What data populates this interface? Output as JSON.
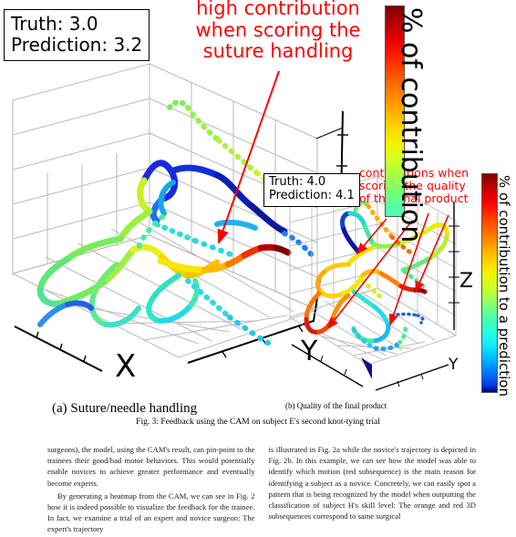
{
  "figure": {
    "subplot_a": {
      "prediction_box": {
        "truth_label": "Truth: 3.0",
        "prediction_label": "Prediction: 3.2"
      },
      "red_annotation": {
        "line1": "high contribution",
        "line2": "when scoring the",
        "line3": "suture handling"
      },
      "axis_x_label": "X",
      "axis_y_label": "Y",
      "caption": "(a) Suture/needle handling"
    },
    "subplot_b": {
      "prediction_box": {
        "truth_label": "Truth: 4.0",
        "prediction_label": "Prediction: 4.1"
      },
      "red_annotation": {
        "line1": "contributions when",
        "line2": "scoring the quality",
        "line3": "of the final product"
      },
      "axis_y_label": "Y",
      "axis_z_label": "Z",
      "caption": "(b) Quality of the final product"
    },
    "colorbar_a": {
      "label": "% of contribution"
    },
    "colorbar_b": {
      "label": "% of contribution to a prediction"
    },
    "fig_caption": "Fig. 3: Feedback using the CAM on subject E's second knot-tying trial"
  },
  "chart_data": {
    "type": "scatter",
    "title": "Fig. 3: Feedback using the CAM on subject E's second knot-tying trial",
    "description": "Two 3D scatter plots of surgical instrument trajectories, each point colored by its CAM contribution percentage using a jet colormap.",
    "xlabel": "X",
    "ylabel": "Y",
    "zlabel": "Z",
    "grid": true,
    "legend_position": "right",
    "panels": [
      {
        "name": "(a) Suture/needle handling",
        "truth": 3.0,
        "prediction": 3.2,
        "colorbar_label": "% of contribution",
        "colormap": "jet-upper-half",
        "annotation": "high contribution when scoring the suture handling"
      },
      {
        "name": "(b) Quality of the final product",
        "truth": 4.0,
        "prediction": 4.1,
        "colorbar_label": "% of contribution to a prediction",
        "colormap": "jet",
        "annotation": "contributions when scoring the quality of the final product"
      }
    ]
  },
  "body_text": {
    "left_column": [
      "surgeons), the model, using the CAM's result, can pin-point to the trainees their good/bad motor behaviors. This would potentially enable novices to achieve greater performance and eventually become experts.",
      "By generating a heatmap from the CAM, we can see in Fig. 2 how it is indeed possible to visualize the feedback for the trainee. In fact, we examine a trial of an expert and novice surgeon: The expert's trajectory"
    ],
    "right_column": [
      "is illustrated in Fig. 2a while the novice's trajectory is depicted in Fig. 2b. In this example, we can see how the model was able to identify which motion (red subsequence) is the main reason for identifying a subject as a novice. Concretely, we can easily spot a pattern that is being recognized by the model when outputting the classification of subject H's skill level: The orange and red 3D subsequences correspond to same surgical"
    ]
  }
}
